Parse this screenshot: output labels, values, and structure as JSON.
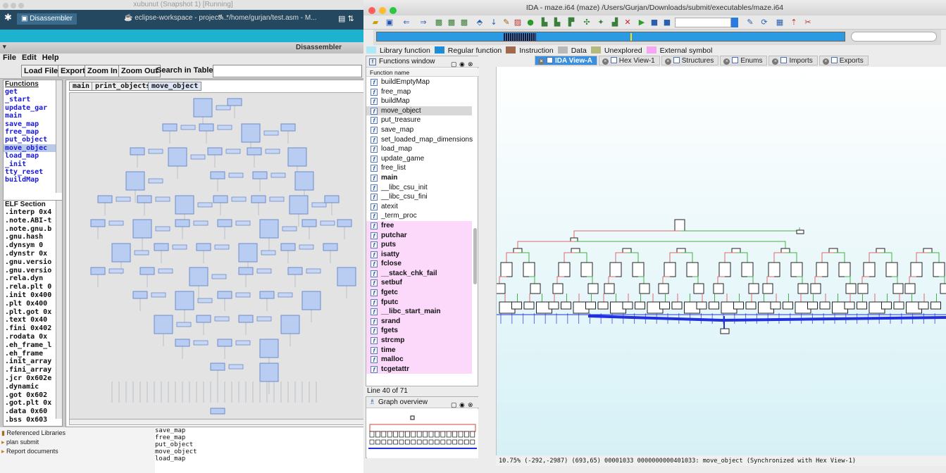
{
  "vm_window": {
    "title": "xubunut (Snapshot 1) [Running]",
    "taskbar": {
      "app": "Disassembler",
      "task1": "eclipse-workspace - project/...",
      "task2": "*/home/gurjan/test.asm - M..."
    },
    "frame_title": "Disassembler",
    "menu": [
      "File",
      "Edit",
      "Help"
    ],
    "toolbar": {
      "load_file": "Load File",
      "export": "Export",
      "zoom_in": "Zoom In",
      "zoom_out": "Zoom Out",
      "search_label": "Search in Table:",
      "search_value": ""
    },
    "functions_header": "Functions",
    "functions": [
      "get",
      "_start",
      "update_gar",
      "main",
      "save_map",
      "free_map",
      "put_object",
      "move_objec",
      "load_map",
      "_init",
      "tty_reset",
      "buildMap"
    ],
    "selected_function": "move_objec",
    "elf_header": "ELF Section",
    "elf_sections": [
      ".interp  0x4",
      ".note.ABI-t",
      ".note.gnu.b",
      ".gnu.hash",
      ".dynsym  0",
      ".dynstr  0x",
      ".gnu.versio",
      ".gnu.versio",
      ".rela.dyn",
      ".rela.plt  0",
      ".init  0x400",
      ".plt  0x400",
      ".plt.got  0x",
      ".text  0x40",
      ".fini  0x402",
      ".rodata  0x",
      ".eh_frame_l",
      ".eh_frame",
      ".init_array",
      ".fini_array",
      ".jcr  0x602e",
      ".dynamic",
      ".got  0x602",
      ".got.plt  0x",
      ".data  0x60",
      ".bss  0x603"
    ],
    "graph_tabs": [
      "main",
      "print_objects",
      "move_object"
    ],
    "active_graph_tab": "move_object",
    "project_items": [
      "Referenced Libraries",
      "plan submit",
      "Report documents"
    ],
    "asm_lines": [
      "save_map",
      "free_map",
      "put_object",
      "move_object",
      "load_map"
    ]
  },
  "ida_window": {
    "title": "IDA - maze.i64 (maze) /Users/Gurjan/Downloads/submit/executables/maze.i64",
    "legend": [
      {
        "label": "Library function",
        "color": "#aee8f5"
      },
      {
        "label": "Regular function",
        "color": "#1e8bd6"
      },
      {
        "label": "Instruction",
        "color": "#a0684c"
      },
      {
        "label": "Data",
        "color": "#b8b8b8"
      },
      {
        "label": "Unexplored",
        "color": "#b5ba7c"
      },
      {
        "label": "External symbol",
        "color": "#f4a6f3"
      }
    ],
    "functions_window": {
      "title": "Functions window",
      "column": "Function name",
      "items": [
        {
          "name": "buildEmptyMap",
          "external": false
        },
        {
          "name": "free_map",
          "external": false
        },
        {
          "name": "buildMap",
          "external": false
        },
        {
          "name": "move_object",
          "external": false,
          "selected": true
        },
        {
          "name": "put_treasure",
          "external": false
        },
        {
          "name": "save_map",
          "external": false
        },
        {
          "name": "set_loaded_map_dimensions",
          "external": false
        },
        {
          "name": "load_map",
          "external": false
        },
        {
          "name": "update_game",
          "external": false
        },
        {
          "name": "free_list",
          "external": false
        },
        {
          "name": "main",
          "external": false,
          "bold": true
        },
        {
          "name": "__libc_csu_init",
          "external": false
        },
        {
          "name": "__libc_csu_fini",
          "external": false
        },
        {
          "name": "atexit",
          "external": false
        },
        {
          "name": "_term_proc",
          "external": false
        },
        {
          "name": "free",
          "external": true
        },
        {
          "name": "putchar",
          "external": true
        },
        {
          "name": "puts",
          "external": true
        },
        {
          "name": "isatty",
          "external": true
        },
        {
          "name": "fclose",
          "external": true
        },
        {
          "name": "__stack_chk_fail",
          "external": true
        },
        {
          "name": "setbuf",
          "external": true
        },
        {
          "name": "fgetc",
          "external": true
        },
        {
          "name": "fputc",
          "external": true
        },
        {
          "name": "__libc_start_main",
          "external": true
        },
        {
          "name": "srand",
          "external": true
        },
        {
          "name": "fgets",
          "external": true
        },
        {
          "name": "strcmp",
          "external": true
        },
        {
          "name": "time",
          "external": true
        },
        {
          "name": "malloc",
          "external": true
        },
        {
          "name": "tcgetattr",
          "external": true
        }
      ],
      "line_status": "Line 40 of 71"
    },
    "overview_title": "Graph overview",
    "tabs": [
      {
        "label": "IDA View-A",
        "active": true
      },
      {
        "label": "Hex View-1",
        "active": false
      },
      {
        "label": "Structures",
        "active": false
      },
      {
        "label": "Enums",
        "active": false
      },
      {
        "label": "Imports",
        "active": false
      },
      {
        "label": "Exports",
        "active": false
      }
    ],
    "status_line": "10.75% (-292,-2987) (693,65) 00001033 0000000000401033: move_object (Synchronized with Hex View-1)"
  }
}
